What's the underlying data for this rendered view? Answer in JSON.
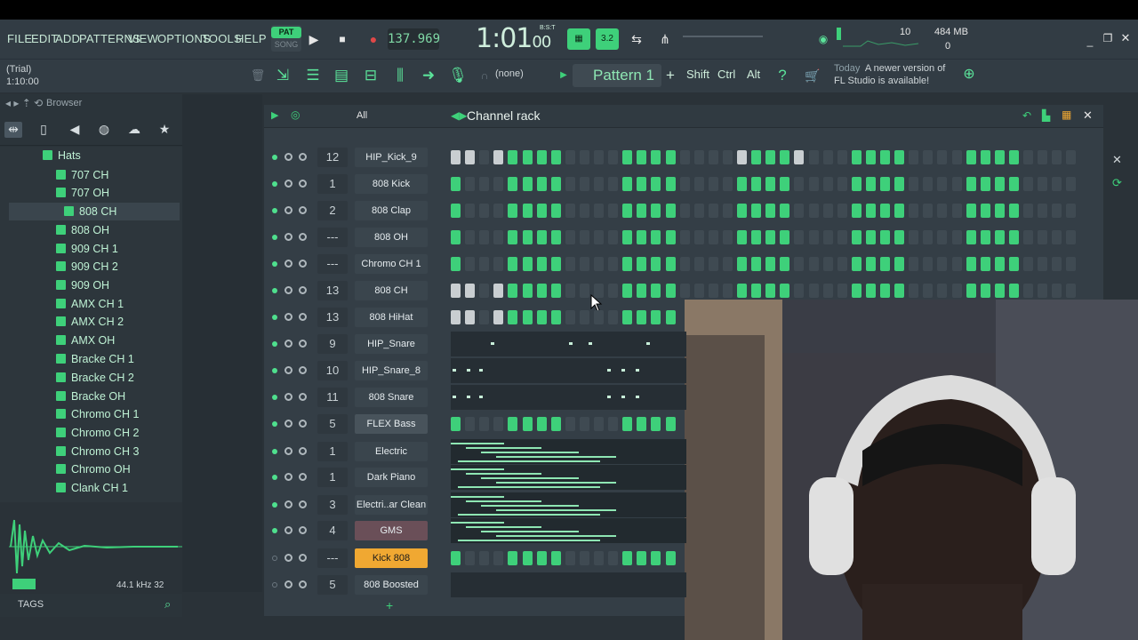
{
  "menu": [
    "FILE",
    "EDIT",
    "ADD",
    "PATTERNS",
    "VIEW",
    "OPTIONS",
    "TOOLS",
    "HELP"
  ],
  "transport": {
    "pat_label": "PAT",
    "song_label": "SONG",
    "tempo": "137.969",
    "time": "1:01",
    "time_small": "00",
    "bst": "B:S:T"
  },
  "greenbtn2": "3.2",
  "cpu": {
    "value": "10",
    "memory": "484 MB",
    "poly": "0"
  },
  "trial": {
    "label": "(Trial)",
    "time": "1:10:00"
  },
  "toolbar": {
    "none": "(none)",
    "pattern": "Pattern 1",
    "shift": "Shift",
    "ctrl": "Ctrl",
    "alt": "Alt"
  },
  "news": {
    "today": "Today",
    "line1": "A newer version of",
    "line2": "FL Studio is available!"
  },
  "browser": {
    "title": "Browser",
    "folder": "Hats",
    "items": [
      "707 CH",
      "707 OH",
      "808 CH",
      "808 OH",
      "909 CH 1",
      "909 CH 2",
      "909 OH",
      "AMX CH 1",
      "AMX CH 2",
      "AMX OH",
      "Bracke CH 1",
      "Bracke CH 2",
      "Bracke OH",
      "Chromo CH 1",
      "Chromo CH 2",
      "Chromo CH 3",
      "Chromo OH",
      "Clank CH 1"
    ],
    "selected_index": 2,
    "samplerate": "44.1 kHz 32",
    "tags": "TAGS"
  },
  "rack": {
    "filter": "All",
    "title": "Channel rack",
    "channels": [
      {
        "num": "12",
        "name": "HIP_Kick_9",
        "style": "normal",
        "led": true
      },
      {
        "num": "1",
        "name": "808 Kick",
        "style": "normal",
        "led": true
      },
      {
        "num": "2",
        "name": "808 Clap",
        "style": "normal",
        "led": true
      },
      {
        "num": "---",
        "name": "808 OH",
        "style": "normal",
        "led": true
      },
      {
        "num": "---",
        "name": "Chromo CH 1",
        "style": "normal",
        "led": true
      },
      {
        "num": "13",
        "name": "808 CH",
        "style": "normal",
        "led": true
      },
      {
        "num": "13",
        "name": "808 HiHat",
        "style": "normal",
        "led": true
      },
      {
        "num": "9",
        "name": "HIP_Snare",
        "style": "normal",
        "led": true
      },
      {
        "num": "10",
        "name": "HIP_Snare_8",
        "style": "normal",
        "led": true
      },
      {
        "num": "11",
        "name": "808 Snare",
        "style": "normal",
        "led": true
      },
      {
        "num": "5",
        "name": "FLEX Bass",
        "style": "pr",
        "led": true
      },
      {
        "num": "1",
        "name": "Electric",
        "style": "normal",
        "led": true
      },
      {
        "num": "1",
        "name": "Dark Piano",
        "style": "normal",
        "led": true
      },
      {
        "num": "3",
        "name": "Electri..ar Clean",
        "style": "normal",
        "led": true
      },
      {
        "num": "4",
        "name": "GMS",
        "style": "pl",
        "led": true
      },
      {
        "num": "---",
        "name": "Kick 808",
        "style": "hl",
        "led": false
      },
      {
        "num": "5",
        "name": "808 Boosted",
        "style": "normal",
        "led": false
      }
    ]
  },
  "colors": {
    "accent": "#3ed07a",
    "highlight": "#f0a832",
    "bg": "#343e46"
  }
}
